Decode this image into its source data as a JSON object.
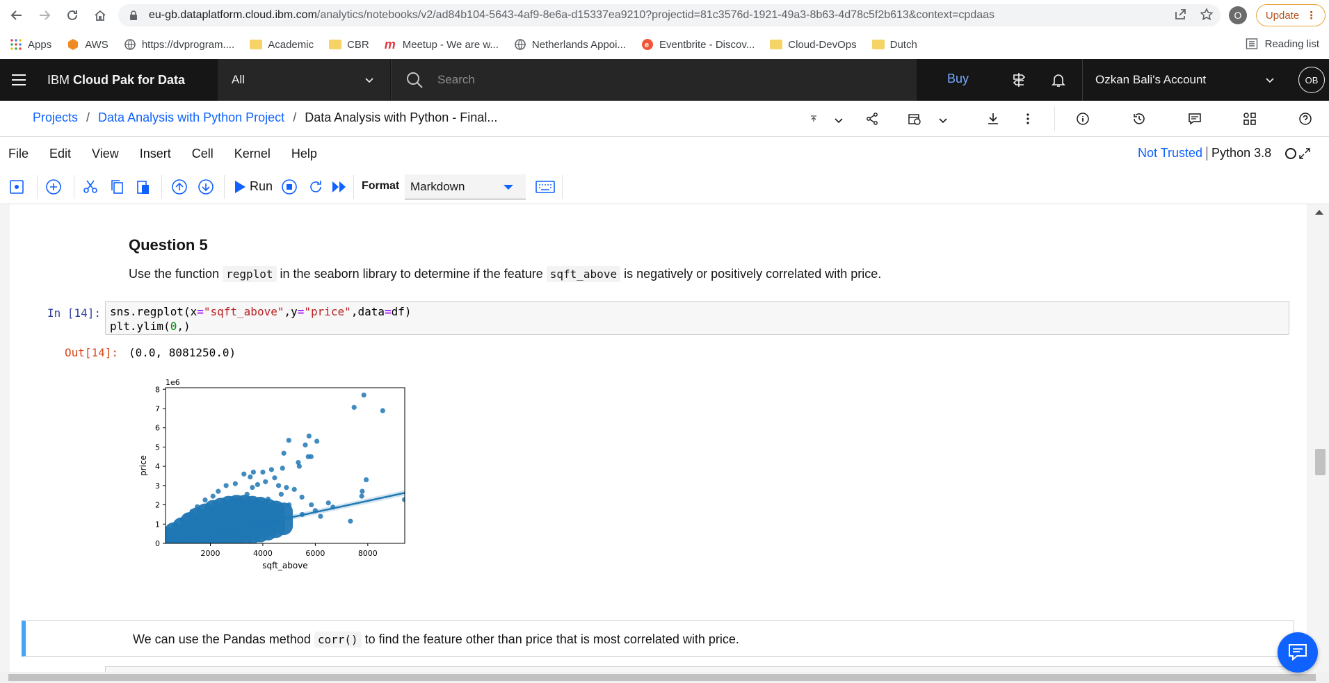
{
  "browser": {
    "url_host": "eu-gb.dataplatform.cloud.ibm.com",
    "url_path": "/analytics/notebooks/v2/ad84b104-5643-4af9-8e6a-d15337ea9210?projectid=81c3576d-1921-49a3-8b63-4d78c5f2b613&context=cpdaas",
    "profile_initial": "O",
    "update_label": "Update",
    "bookmarks": [
      {
        "label": "Apps",
        "icon": "apps-grid-icon"
      },
      {
        "label": "AWS",
        "icon": "aws-icon"
      },
      {
        "label": "https://dvprogram....",
        "icon": "globe-icon"
      },
      {
        "label": "Academic",
        "icon": "folder-icon"
      },
      {
        "label": "CBR",
        "icon": "folder-icon"
      },
      {
        "label": "Meetup - We are w...",
        "icon": "meetup-icon"
      },
      {
        "label": "Netherlands Appoi...",
        "icon": "globe-icon"
      },
      {
        "label": "Eventbrite - Discov...",
        "icon": "eventbrite-icon"
      },
      {
        "label": "Cloud-DevOps",
        "icon": "folder-icon"
      },
      {
        "label": "Dutch",
        "icon": "folder-icon"
      }
    ],
    "reading_list": "Reading list"
  },
  "ibm_bar": {
    "brand_prefix": "IBM ",
    "brand_bold": "Cloud Pak for Data",
    "scope": "All",
    "search_placeholder": "Search",
    "buy": "Buy",
    "account": "Ozkan Bali's Account",
    "avatar": "OB"
  },
  "breadcrumb": {
    "projects": "Projects",
    "project": "Data Analysis with Python Project",
    "current": "Data Analysis with Python - Final...",
    "separator": "/"
  },
  "menu": [
    "File",
    "Edit",
    "View",
    "Insert",
    "Cell",
    "Kernel",
    "Help"
  ],
  "kernel": {
    "trust": "Not Trusted",
    "name": "Python 3.8"
  },
  "toolbar": {
    "run": "Run",
    "format_label": "Format",
    "format_value": "Markdown"
  },
  "notebook": {
    "question_title": "Question 5",
    "question_text_1": "Use the function ",
    "question_code_1": "regplot",
    "question_text_2": " in the seaborn library to determine if the feature ",
    "question_code_2": "sqft_above",
    "question_text_3": " is negatively or positively correlated with price.",
    "in_prompt": "In [14]:",
    "code_line1": {
      "a": "sns.regplot(x",
      "b": "=",
      "c": "\"sqft_above\"",
      "d": ",y",
      "e": "=",
      "f": "\"price\"",
      "g": ",data",
      "h": "=",
      "i": "df)"
    },
    "code_line2": {
      "a": "plt.ylim(",
      "b": "0",
      "c": ",)"
    },
    "out_prompt": "Out[14]:",
    "out_text": "(0.0, 8081250.0)",
    "md_text_1": "We can use the Pandas method ",
    "md_code": "corr()",
    "md_text_2": " to find the feature other than price that is most correlated with price."
  },
  "chart_data": {
    "type": "scatter",
    "xlabel": "sqft_above",
    "ylabel": "price",
    "y_offset_label": "1e6",
    "xlim": [
      290,
      9410
    ],
    "ylim": [
      0,
      8081250
    ],
    "x_ticks": [
      2000,
      4000,
      6000,
      8000
    ],
    "y_ticks": [
      0,
      1,
      2,
      3,
      4,
      5,
      6,
      7,
      8
    ],
    "point_color": "#1f77b4",
    "regression": {
      "x": [
        290,
        9410
      ],
      "y": [
        -60000,
        2620000
      ]
    },
    "points": [
      {
        "x": 7850,
        "y": 7700000
      },
      {
        "x": 8570,
        "y": 6890000
      },
      {
        "x": 7480,
        "y": 7060000
      },
      {
        "x": 5760,
        "y": 5570000
      },
      {
        "x": 6060,
        "y": 5300000
      },
      {
        "x": 5620,
        "y": 5110000
      },
      {
        "x": 4990,
        "y": 5350000
      },
      {
        "x": 5730,
        "y": 4500000
      },
      {
        "x": 5840,
        "y": 4500000
      },
      {
        "x": 4800,
        "y": 4680000
      },
      {
        "x": 5350,
        "y": 4200000
      },
      {
        "x": 5390,
        "y": 4000000
      },
      {
        "x": 4750,
        "y": 3900000
      },
      {
        "x": 4330,
        "y": 3830000
      },
      {
        "x": 4000,
        "y": 3700000
      },
      {
        "x": 3640,
        "y": 3700000
      },
      {
        "x": 3280,
        "y": 3600000
      },
      {
        "x": 3520,
        "y": 3450000
      },
      {
        "x": 4450,
        "y": 3400000
      },
      {
        "x": 7940,
        "y": 3300000
      },
      {
        "x": 7790,
        "y": 2700000
      },
      {
        "x": 7770,
        "y": 2450000
      },
      {
        "x": 9400,
        "y": 2270000
      },
      {
        "x": 6670,
        "y": 1880000
      },
      {
        "x": 7340,
        "y": 1150000
      },
      {
        "x": 6000,
        "y": 1700000
      },
      {
        "x": 5490,
        "y": 2400000
      },
      {
        "x": 5850,
        "y": 2000000
      },
      {
        "x": 5200,
        "y": 2800000
      },
      {
        "x": 4900,
        "y": 2900000
      },
      {
        "x": 4600,
        "y": 3000000
      },
      {
        "x": 4100,
        "y": 3200000
      },
      {
        "x": 3800,
        "y": 3050000
      },
      {
        "x": 3600,
        "y": 2900000
      },
      {
        "x": 2950,
        "y": 3100000
      },
      {
        "x": 2600,
        "y": 3000000
      },
      {
        "x": 2300,
        "y": 2700000
      },
      {
        "x": 2100,
        "y": 2450000
      },
      {
        "x": 1800,
        "y": 2250000
      },
      {
        "x": 1500,
        "y": 1900000
      },
      {
        "x": 1300,
        "y": 1650000
      },
      {
        "x": 1100,
        "y": 1450000
      },
      {
        "x": 900,
        "y": 1200000
      },
      {
        "x": 700,
        "y": 950000
      },
      {
        "x": 500,
        "y": 650000
      },
      {
        "x": 400,
        "y": 250000
      },
      {
        "x": 5000,
        "y": 2000000
      },
      {
        "x": 5500,
        "y": 1500000
      },
      {
        "x": 6200,
        "y": 1400000
      },
      {
        "x": 6500,
        "y": 2100000
      },
      {
        "x": 4500,
        "y": 1100000
      },
      {
        "x": 3800,
        "y": 1950000
      },
      {
        "x": 4200,
        "y": 2300000
      },
      {
        "x": 4700,
        "y": 2550000
      },
      {
        "x": 3400,
        "y": 2550000
      },
      {
        "x": 3000,
        "y": 2250000
      },
      {
        "x": 2800,
        "y": 1850000
      }
    ],
    "dense_bands": [
      {
        "x": 300,
        "y0": 0,
        "y1": 380000
      },
      {
        "x": 600,
        "y0": 40000,
        "y1": 620000
      },
      {
        "x": 900,
        "y0": 70000,
        "y1": 880000
      },
      {
        "x": 1200,
        "y0": 100000,
        "y1": 1150000
      },
      {
        "x": 1500,
        "y0": 130000,
        "y1": 1400000
      },
      {
        "x": 1800,
        "y0": 160000,
        "y1": 1600000
      },
      {
        "x": 2100,
        "y0": 190000,
        "y1": 1780000
      },
      {
        "x": 2400,
        "y0": 230000,
        "y1": 1900000
      },
      {
        "x": 2700,
        "y0": 270000,
        "y1": 2000000
      },
      {
        "x": 3000,
        "y0": 320000,
        "y1": 2050000
      },
      {
        "x": 3300,
        "y0": 380000,
        "y1": 2050000
      },
      {
        "x": 3600,
        "y0": 440000,
        "y1": 2000000
      },
      {
        "x": 3900,
        "y0": 520000,
        "y1": 1950000
      },
      {
        "x": 4200,
        "y0": 620000,
        "y1": 1850000
      },
      {
        "x": 4500,
        "y0": 750000,
        "y1": 1750000
      },
      {
        "x": 4800,
        "y0": 900000,
        "y1": 1650000
      }
    ]
  }
}
